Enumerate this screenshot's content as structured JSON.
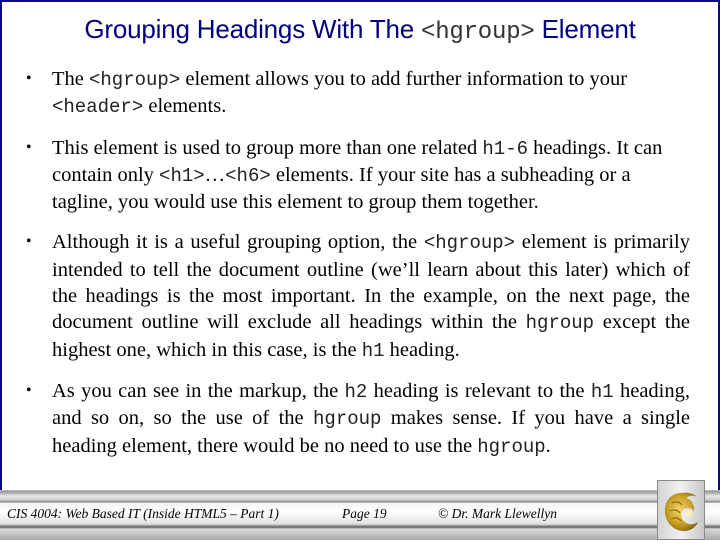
{
  "slide": {
    "title": {
      "before": "Grouping Headings With The ",
      "code": "<hgroup>",
      "after": " Element"
    },
    "bullets": [
      {
        "parts": [
          {
            "t": "The ",
            "code": false
          },
          {
            "t": "<hgroup>",
            "code": true
          },
          {
            "t": " element allows you to add further information to your ",
            "code": false
          },
          {
            "t": "<header>",
            "code": true
          },
          {
            "t": " elements.",
            "code": false
          }
        ]
      },
      {
        "parts": [
          {
            "t": "This element is used to group more than one related ",
            "code": false
          },
          {
            "t": "h1-6",
            "code": true
          },
          {
            "t": " headings.  It can contain only ",
            "code": false
          },
          {
            "t": "<h1>",
            "code": true
          },
          {
            "t": "…",
            "code": false
          },
          {
            "t": "<h6>",
            "code": true
          },
          {
            "t": " elements. If your site has a subheading or a tagline, you would use this element to group them together.",
            "code": false
          }
        ]
      },
      {
        "parts": [
          {
            "t": "Although it is a useful grouping option, the ",
            "code": false
          },
          {
            "t": "<hgroup>",
            "code": true
          },
          {
            "t": " element is primarily intended to tell the document outline (we’ll learn about this later) which of the headings is the most important.  In the example, on the next page, the document outline will exclude all headings within the ",
            "code": false
          },
          {
            "t": "hgroup",
            "code": true
          },
          {
            "t": " except the highest one, which in this case, is the ",
            "code": false
          },
          {
            "t": "h1",
            "code": true
          },
          {
            "t": " heading.",
            "code": false
          }
        ]
      },
      {
        "parts": [
          {
            "t": "As you can see in the markup, the ",
            "code": false
          },
          {
            "t": "h2",
            "code": true
          },
          {
            "t": " heading is relevant to the ",
            "code": false
          },
          {
            "t": "h1",
            "code": true
          },
          {
            "t": " heading, and so on, so the use of the ",
            "code": false
          },
          {
            "t": "hgroup",
            "code": true
          },
          {
            "t": " makes sense.  If you have a single heading element, there would be no need to use the ",
            "code": false
          },
          {
            "t": "hgroup",
            "code": true
          },
          {
            "t": ".",
            "code": false
          }
        ]
      }
    ],
    "bullet_glyph": "•"
  },
  "footer": {
    "course": "CIS 4004: Web Based IT (Inside HTML5 – Part 1)",
    "page": "Page 19",
    "copyright": "© Dr. Mark Llewellyn",
    "logo_icon": "pegasus-logo-icon"
  },
  "colors": {
    "title": "#000080",
    "border": "#0b0b8a",
    "logo_gold": "#c9a227"
  }
}
